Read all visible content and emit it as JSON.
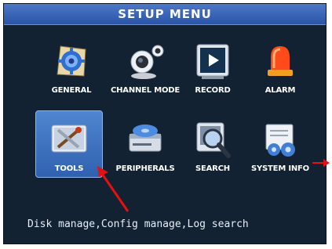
{
  "header": {
    "title": "SETUP  MENU"
  },
  "menu": {
    "items": [
      {
        "label": "GENERAL",
        "icon": "gear-icon",
        "selected": false
      },
      {
        "label": "CHANNEL MODE",
        "icon": "webcam-icon",
        "selected": false
      },
      {
        "label": "RECORD",
        "icon": "play-icon",
        "selected": false
      },
      {
        "label": "ALARM",
        "icon": "siren-icon",
        "selected": false
      },
      {
        "label": "TOOLS",
        "icon": "tools-icon",
        "selected": true
      },
      {
        "label": "PERIPHERALS",
        "icon": "disk-drive-icon",
        "selected": false
      },
      {
        "label": "SEARCH",
        "icon": "magnifier-icon",
        "selected": false
      },
      {
        "label": "SYSTEM INFO",
        "icon": "system-info-icon",
        "selected": false
      }
    ]
  },
  "status": {
    "text": "Disk manage,Config manage,Log search"
  },
  "colors": {
    "background": "#122233",
    "title_bar": "#2a55a8",
    "selected_tile": "#3a6cbc",
    "annotation_arrow": "#e51010"
  }
}
